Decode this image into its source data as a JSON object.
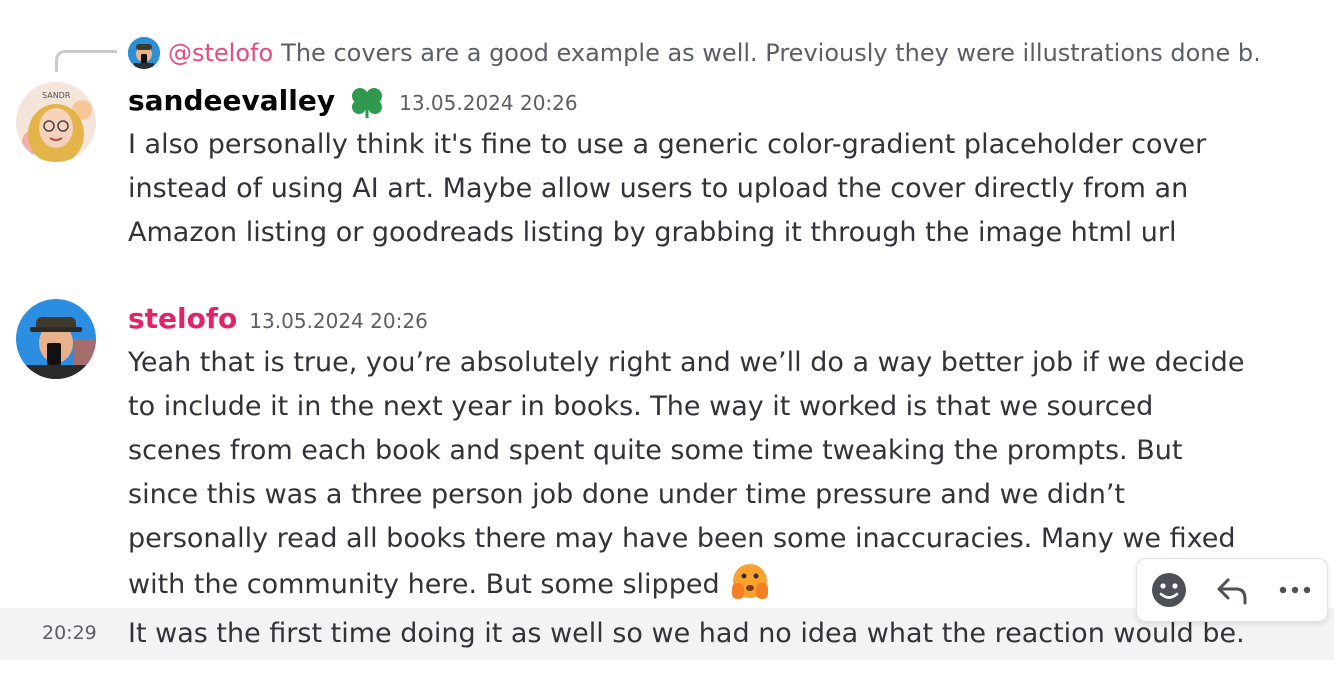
{
  "reply": {
    "mention": "@stelofo",
    "text": "The covers are a good example as well. Previously they were illustrations done b…"
  },
  "messages": [
    {
      "author": "sandeevalley",
      "timestamp": "13.05.2024 20:26",
      "badge_icon": "clover-badge-icon",
      "text": "I also personally think it's fine to use a generic color-gradient placeholder cover instead of using AI art. Maybe allow users to upload the cover directly from an Amazon listing or goodreads listing by grabbing it through the image html url"
    },
    {
      "author": "stelofo",
      "timestamp": "13.05.2024 20:26",
      "text": "Yeah that is true, you’re absolutely right and we’ll do a way better job if we decide to include it in the next year in books. The way it worked is that we sourced scenes from each book and spent quite some time tweaking the prompts. But since this was a three person job done under time pressure and we didn’t personally read all books there may have been some inaccuracies. Many we fixed with the community here. But some slipped",
      "emoji": "face-with-open-eyes-and-hand-over-mouth-emoji"
    }
  ],
  "continuation": {
    "time": "20:29",
    "text": "It was the first time doing it as well so we had no idea what the reaction would be."
  },
  "toolbar": {
    "icons": [
      "add-reaction-icon",
      "reply-icon",
      "more-options-icon"
    ]
  },
  "colors": {
    "mention": "#e8497f",
    "stelofo_name": "#e4226c",
    "hover_row": "#f2f3f5",
    "badge_green": "#2f9a4e"
  }
}
